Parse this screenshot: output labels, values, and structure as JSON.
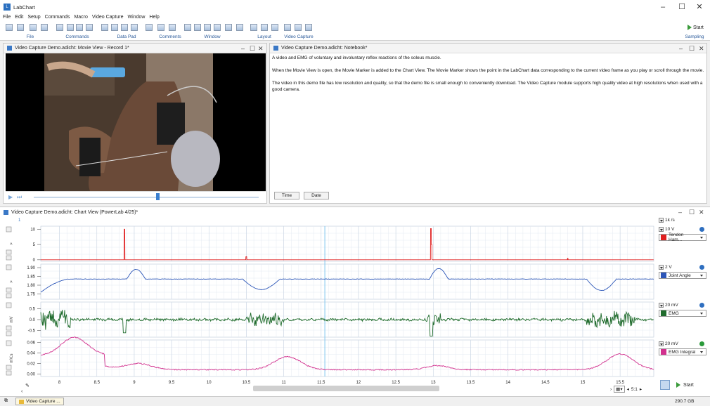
{
  "window": {
    "title": "LabChart",
    "min": "–",
    "max": "☐",
    "close": "✕"
  },
  "menu": [
    "File",
    "Edit",
    "Setup",
    "Commands",
    "Macro",
    "Video Capture",
    "Window",
    "Help"
  ],
  "ribbon": {
    "groups": [
      "File",
      "Commands",
      "Data Pad",
      "Comments",
      "Window",
      "Layout",
      "Video Capture"
    ],
    "start_label": "Start",
    "sampling_label": "Sampling"
  },
  "movie_panel": {
    "title": "Video Capture Demo.adicht: Movie View - Record 1*"
  },
  "notebook_panel": {
    "title": "Video Capture Demo.adicht: Notebook*",
    "paragraphs": [
      "A video and EMG of voluntary and involuntary reflex reactions of the soleus muscle.",
      "When the Movie View is open, the Movie Marker is added to the Chart View. The Movie Marker shows the point in the LabChart data corresponding to the current video frame as you play or scroll through the movie.",
      "The video in this demo file has low resolution and quality, so that the demo file is small enough to conveniently download. The Video Capture module supports high quality video at high resolutions when used with a good camera."
    ],
    "time_button": "Time",
    "date_button": "Date"
  },
  "chart_panel": {
    "title": "Video Capture Demo.adicht: Chart View (PowerLab 4/25)*",
    "rate": "1k /s",
    "marker_label": "1",
    "start_label": "Start",
    "zoom": "5:1"
  },
  "channels": [
    {
      "name": "Tendon Ham...",
      "range": "10 V",
      "unit": ">",
      "ticks": [
        "10",
        "5",
        "0"
      ],
      "color": "#e02020",
      "info_color": "#2f6fc0"
    },
    {
      "name": "Joint Angle",
      "range": "2 V",
      "unit": ">",
      "ticks": [
        "1.90",
        "1.85",
        "1.80",
        "1.75"
      ],
      "color": "#2c56b8",
      "info_color": "#2f6fc0"
    },
    {
      "name": "EMG",
      "range": "20 mV",
      "unit": "mV",
      "ticks": [
        "0.5",
        "0.0",
        "-0.5"
      ],
      "color": "#1f6b2c",
      "info_color": "#2f6fc0"
    },
    {
      "name": "EMG Integral",
      "range": "20 mV",
      "unit": "mV.s",
      "ticks": [
        "0.06",
        "0.04",
        "0.02",
        "0.00"
      ],
      "color": "#d2308e",
      "info_color": "#2a9a3a"
    }
  ],
  "time_axis": {
    "ticks": [
      "8",
      "8.5",
      "9",
      "9.5",
      "10",
      "10.5",
      "11",
      "11.5",
      "12",
      "12.5",
      "13",
      "13.5",
      "14",
      "14.5",
      "15",
      "15.5"
    ]
  },
  "status": {
    "task": "Video Capture ...",
    "disk": "290.7 GB"
  }
}
